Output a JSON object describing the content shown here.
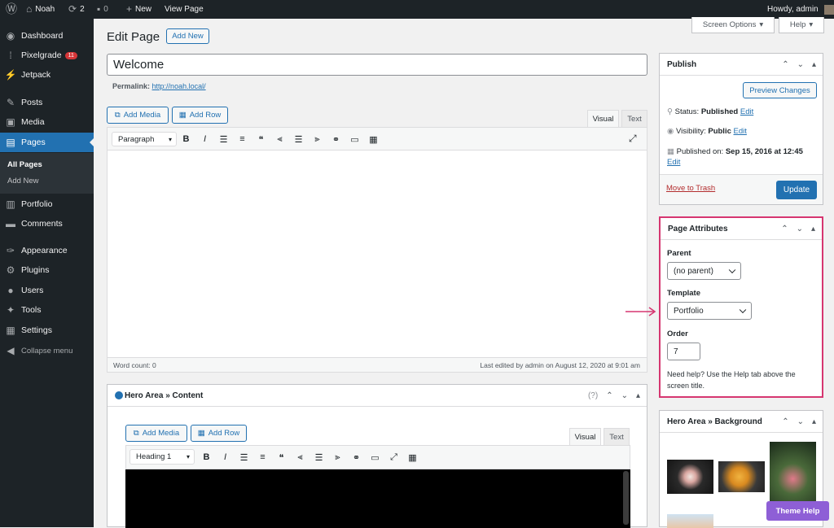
{
  "adminbar": {
    "site": "Noah",
    "updates": "2",
    "comments": "0",
    "new": "New",
    "view": "View Page",
    "howdy": "Howdy, admin"
  },
  "menu": {
    "items": [
      {
        "icon": "dashboard-icon",
        "glyph": "◉",
        "label": "Dashboard"
      },
      {
        "icon": "pixelgrade-icon",
        "glyph": "⁞",
        "label": "Pixelgrade",
        "badge": "11"
      },
      {
        "icon": "jetpack-icon",
        "glyph": "⚡",
        "label": "Jetpack"
      },
      {
        "icon": "posts-icon",
        "glyph": "✎",
        "label": "Posts"
      },
      {
        "icon": "media-icon",
        "glyph": "▣",
        "label": "Media"
      },
      {
        "icon": "pages-icon",
        "glyph": "▤",
        "label": "Pages"
      },
      {
        "icon": "portfolio-icon",
        "glyph": "▥",
        "label": "Portfolio"
      },
      {
        "icon": "comments-icon",
        "glyph": "▬",
        "label": "Comments"
      },
      {
        "icon": "appearance-icon",
        "glyph": "✑",
        "label": "Appearance"
      },
      {
        "icon": "plugins-icon",
        "glyph": "⚙",
        "label": "Plugins"
      },
      {
        "icon": "users-icon",
        "glyph": "●",
        "label": "Users"
      },
      {
        "icon": "tools-icon",
        "glyph": "✦",
        "label": "Tools"
      },
      {
        "icon": "settings-icon",
        "glyph": "▦",
        "label": "Settings"
      },
      {
        "icon": "collapse-icon",
        "glyph": "◀",
        "label": "Collapse menu"
      }
    ],
    "sub": [
      "All Pages",
      "Add New"
    ]
  },
  "header": {
    "title": "Edit Page",
    "add_new": "Add New",
    "screen_options": "Screen Options",
    "help": "Help"
  },
  "post": {
    "title": "Welcome",
    "permalink_label": "Permalink:",
    "permalink_url": "http://noah.local/"
  },
  "editor": {
    "add_media": "Add Media",
    "add_row": "Add Row",
    "tab_visual": "Visual",
    "tab_text": "Text",
    "format": "Paragraph",
    "word_count": "Word count: 0",
    "last_edited": "Last edited by admin on August 12, 2020 at 9:01 am"
  },
  "hero": {
    "title": "Hero Area » Content",
    "help_q": "(?)",
    "add_media": "Add Media",
    "add_row": "Add Row",
    "tab_visual": "Visual",
    "tab_text": "Text",
    "format": "Heading 1"
  },
  "publish": {
    "title": "Publish",
    "preview": "Preview Changes",
    "status_label": "Status:",
    "status": "Published",
    "visibility_label": "Visibility:",
    "visibility": "Public",
    "published_label": "Published on:",
    "published_on": "Sep 15, 2016 at 12:45",
    "edit": "Edit",
    "trash": "Move to Trash",
    "update": "Update"
  },
  "attrs": {
    "title": "Page Attributes",
    "parent_label": "Parent",
    "parent": "(no parent)",
    "template_label": "Template",
    "template": "Portfolio",
    "order_label": "Order",
    "order": "7",
    "help": "Need help? Use the Help tab above the screen title.",
    "highlight": "#d63670"
  },
  "bg": {
    "title": "Hero Area » Background"
  },
  "theme_help": "Theme Help",
  "colors": {
    "accent": "#2271b1",
    "adminbar": "#1d2327",
    "theme_help": "#8e5fd6"
  }
}
